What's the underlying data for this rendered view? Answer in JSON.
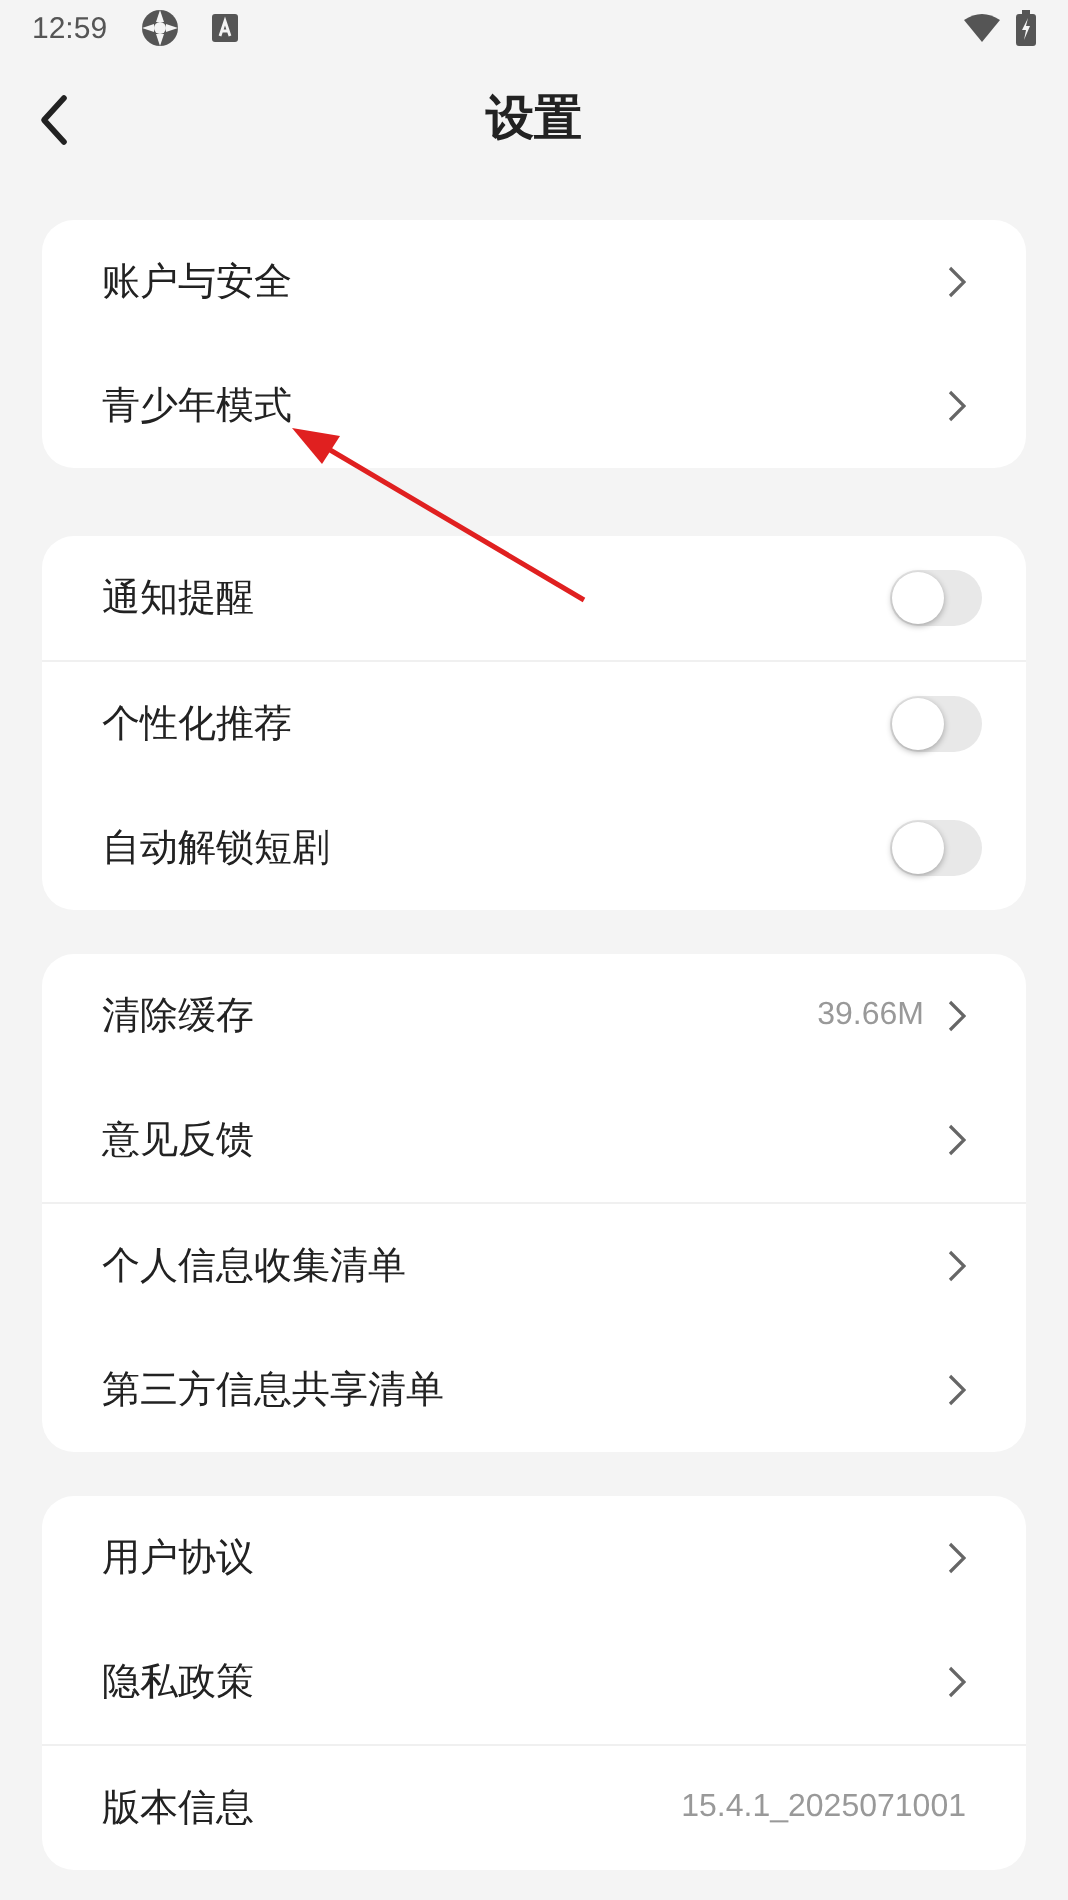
{
  "status_bar": {
    "time": "12:59"
  },
  "header": {
    "title": "设置"
  },
  "groups": [
    {
      "items": [
        {
          "kind": "link",
          "label": "账户与安全",
          "divider": false
        },
        {
          "kind": "link",
          "label": "青少年模式",
          "divider": false
        }
      ]
    },
    {
      "items": [
        {
          "kind": "toggle",
          "label": "通知提醒",
          "on": false,
          "divider": false
        },
        {
          "kind": "toggle",
          "label": "个性化推荐",
          "on": false,
          "divider": true
        },
        {
          "kind": "toggle",
          "label": "自动解锁短剧",
          "on": false,
          "divider": false
        }
      ]
    },
    {
      "items": [
        {
          "kind": "link",
          "label": "清除缓存",
          "value": "39.66M",
          "divider": false
        },
        {
          "kind": "link",
          "label": "意见反馈",
          "divider": false
        },
        {
          "kind": "link",
          "label": "个人信息收集清单",
          "divider": true
        },
        {
          "kind": "link",
          "label": "第三方信息共享清单",
          "divider": false
        }
      ]
    },
    {
      "items": [
        {
          "kind": "link",
          "label": "用户协议",
          "divider": false
        },
        {
          "kind": "link",
          "label": "隐私政策",
          "divider": false
        },
        {
          "kind": "info",
          "label": "版本信息",
          "value": "15.4.1_2025071001",
          "divider": true
        }
      ]
    }
  ],
  "pointer_arrow": {
    "color": "#e02020"
  }
}
